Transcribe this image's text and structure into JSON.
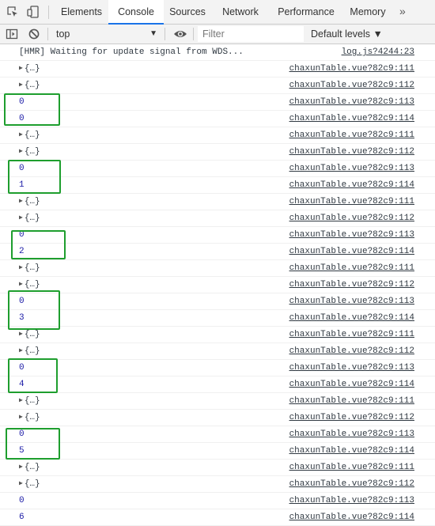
{
  "tabbar": {
    "tabs": [
      {
        "label": "Elements"
      },
      {
        "label": "Console"
      },
      {
        "label": "Sources"
      },
      {
        "label": "Network"
      },
      {
        "label": "Performance"
      },
      {
        "label": "Memory"
      }
    ],
    "active_tab": "Console",
    "more_glyph": "»"
  },
  "toolbar": {
    "context": "top",
    "context_caret": "▼",
    "filter_placeholder": "Filter",
    "levels": "Default levels ▼"
  },
  "console": {
    "rows": [
      {
        "text": "[HMR] Waiting for update signal from WDS...",
        "src": "log.js?4244:23"
      },
      {
        "text": "{…}",
        "src": "chaxunTable.vue?82c9:111"
      },
      {
        "text": "{…}",
        "src": "chaxunTable.vue?82c9:112"
      },
      {
        "text": "0",
        "src": "chaxunTable.vue?82c9:113"
      },
      {
        "text": "0",
        "src": "chaxunTable.vue?82c9:114"
      },
      {
        "text": "{…}",
        "src": "chaxunTable.vue?82c9:111"
      },
      {
        "text": "{…}",
        "src": "chaxunTable.vue?82c9:112"
      },
      {
        "text": "0",
        "src": "chaxunTable.vue?82c9:113"
      },
      {
        "text": "1",
        "src": "chaxunTable.vue?82c9:114"
      },
      {
        "text": "{…}",
        "src": "chaxunTable.vue?82c9:111"
      },
      {
        "text": "{…}",
        "src": "chaxunTable.vue?82c9:112"
      },
      {
        "text": "0",
        "src": "chaxunTable.vue?82c9:113"
      },
      {
        "text": "2",
        "src": "chaxunTable.vue?82c9:114"
      },
      {
        "text": "{…}",
        "src": "chaxunTable.vue?82c9:111"
      },
      {
        "text": "{…}",
        "src": "chaxunTable.vue?82c9:112"
      },
      {
        "text": "0",
        "src": "chaxunTable.vue?82c9:113"
      },
      {
        "text": "3",
        "src": "chaxunTable.vue?82c9:114"
      },
      {
        "text": "{…}",
        "src": "chaxunTable.vue?82c9:111"
      },
      {
        "text": "{…}",
        "src": "chaxunTable.vue?82c9:112"
      },
      {
        "text": "0",
        "src": "chaxunTable.vue?82c9:113"
      },
      {
        "text": "4",
        "src": "chaxunTable.vue?82c9:114"
      },
      {
        "text": "{…}",
        "src": "chaxunTable.vue?82c9:111"
      },
      {
        "text": "{…}",
        "src": "chaxunTable.vue?82c9:112"
      },
      {
        "text": "0",
        "src": "chaxunTable.vue?82c9:113"
      },
      {
        "text": "5",
        "src": "chaxunTable.vue?82c9:114"
      },
      {
        "text": "{…}",
        "src": "chaxunTable.vue?82c9:111"
      },
      {
        "text": "{…}",
        "src": "chaxunTable.vue?82c9:112"
      },
      {
        "text": "0",
        "src": "chaxunTable.vue?82c9:113"
      },
      {
        "text": "6",
        "src": "chaxunTable.vue?82c9:114"
      }
    ]
  },
  "colors": {
    "highlight": "#1e9e2e",
    "number": "#1a1aa6",
    "active_tab_underline": "#1a73e8"
  },
  "icons": [
    "inspect-element-icon",
    "device-toolbar-icon",
    "sidebar-toggle-icon",
    "clear-console-icon",
    "eye-icon",
    "expand-triangle-icon"
  ]
}
